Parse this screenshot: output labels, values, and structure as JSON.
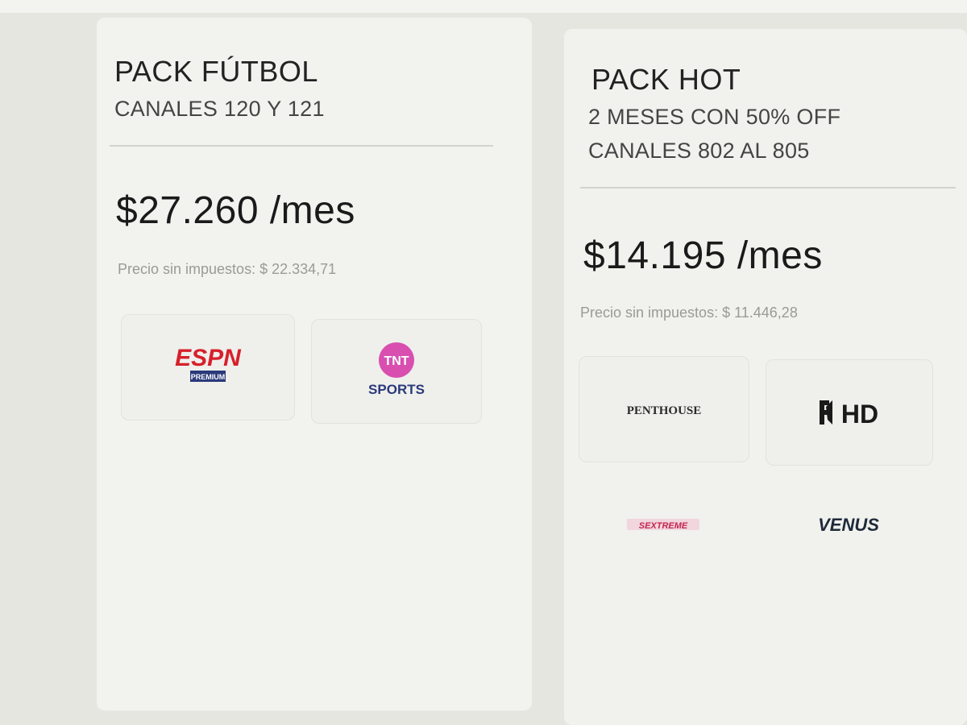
{
  "packs": [
    {
      "title": "PACK FÚTBOL",
      "subtitle_lines": [
        "CANALES 120 Y 121"
      ],
      "price": "$27.260 /mes",
      "price_no_tax": "Precio sin impuestos: $ 22.334,71",
      "channels": [
        {
          "name": "ESPN Premium",
          "logo_text": "ESPN",
          "logo_subtext": "PREMIUM",
          "icon": "espn-premium-logo"
        },
        {
          "name": "TNT Sports",
          "logo_text": "TNT",
          "logo_subtext": "SPORTS",
          "icon": "tnt-sports-logo"
        }
      ]
    },
    {
      "title": "PACK HOT",
      "subtitle_lines": [
        "2 MESES CON 50% OFF",
        "CANALES 802 AL 805"
      ],
      "price": "$14.195 /mes",
      "price_no_tax": "Precio sin impuestos: $ 11.446,28",
      "channels": [
        {
          "name": "Penthouse",
          "logo_text": "PENTHOUSE",
          "icon": "penthouse-logo"
        },
        {
          "name": "HD",
          "logo_text": "HD",
          "icon": "hd-channel-logo"
        },
        {
          "name": "Sextreme",
          "logo_text": "SEXTREME",
          "icon": "sextreme-logo"
        },
        {
          "name": "Venus",
          "logo_text": "VENUS",
          "icon": "venus-logo"
        }
      ]
    }
  ],
  "colors": {
    "espn_red": "#d6202b",
    "espn_bar": "#2a3a7a",
    "tnt_pink": "#d84fb0",
    "text_dark": "#1e1e1e",
    "text_muted": "#9a9a96"
  }
}
